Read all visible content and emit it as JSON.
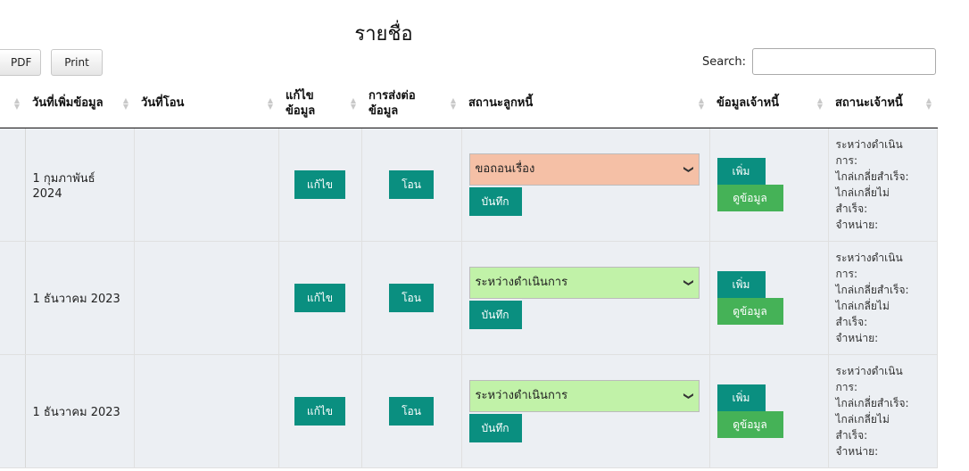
{
  "page": {
    "title": "รายชื่อ"
  },
  "toolbar": {
    "pdf_label": "PDF",
    "print_label": "Print",
    "search_label": "Search:",
    "search_value": ""
  },
  "columns": [
    "",
    "วันที่เพิ่มข้อมูล",
    "วันที่โอน",
    "แก้ไข ข้อมูล",
    "การส่งต่อ ข้อมูล",
    "สถานะลูกหนี้",
    "ข้อมูลเจ้าหนี้",
    "สถานะเจ้าหนี้"
  ],
  "buttons": {
    "edit": "แก้ไข",
    "transfer": "โอน",
    "save": "บันทึก",
    "add": "เพิ่ม",
    "view": "ดูข้อมูล"
  },
  "creditor_status_lines": [
    "ระหว่างดำเนิน",
    "การ:",
    "ไกล่เกลี่ยสำเร็จ:",
    "ไกล่เกลี่ยไม่",
    "สำเร็จ:",
    "จำหน่าย:"
  ],
  "rows": [
    {
      "date_added": "1 กุมภาพันธ์ 2024",
      "transfer_date": "",
      "debtor_status": "ขอถอนเรื่อง",
      "status_color": "#f5c0a6"
    },
    {
      "date_added": "1 ธันวาคม 2023",
      "transfer_date": "",
      "debtor_status": "ระหว่างดำเนินการ",
      "status_color": "#c1f2a8"
    },
    {
      "date_added": "1 ธันวาคม 2023",
      "transfer_date": "",
      "debtor_status": "ระหว่างดำเนินการ",
      "status_color": "#c1f2a8"
    }
  ]
}
